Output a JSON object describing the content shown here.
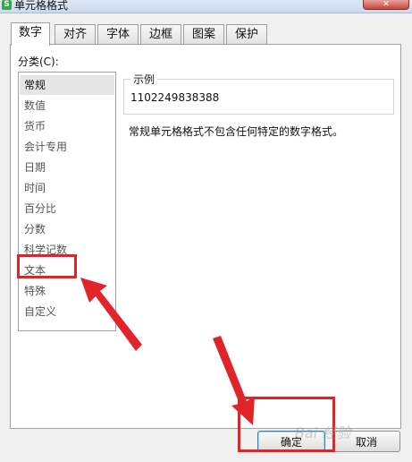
{
  "window": {
    "title": "单元格格式",
    "app_icon": "S"
  },
  "tabs": [
    {
      "label": "数字",
      "active": true
    },
    {
      "label": "对齐"
    },
    {
      "label": "字体"
    },
    {
      "label": "边框"
    },
    {
      "label": "图案"
    },
    {
      "label": "保护"
    }
  ],
  "category": {
    "label": "分类(C):",
    "items": [
      "常规",
      "数值",
      "货币",
      "会计专用",
      "日期",
      "时间",
      "百分比",
      "分数",
      "科学记数",
      "文本",
      "特殊",
      "自定义"
    ],
    "selected": "常规",
    "highlighted": "文本"
  },
  "sample": {
    "legend": "示例",
    "value": "1102249838388"
  },
  "description": "常规单元格格式不包含任何特定的数字格式。",
  "buttons": {
    "ok": "确定",
    "cancel": "取消"
  },
  "watermark": "Bai 经验",
  "annotation_color": "#e0242a",
  "icons": [
    "app-logo-icon",
    "close-icon"
  ]
}
